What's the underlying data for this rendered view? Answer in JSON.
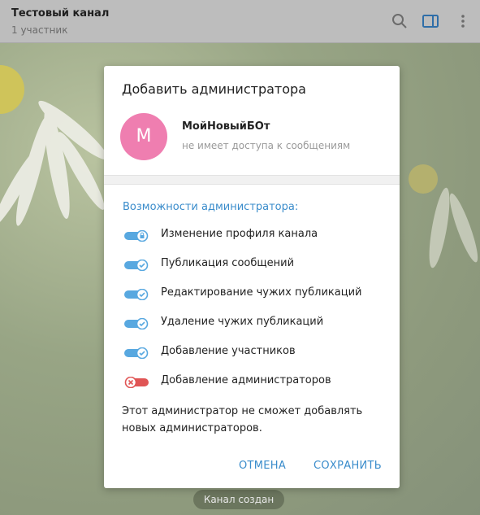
{
  "header": {
    "title": "Тестовый канал",
    "subtitle": "1 участник",
    "icons": [
      "search-icon",
      "sidebar-toggle-icon",
      "more-vertical-icon"
    ]
  },
  "background": {
    "pill_text": "Канал создан"
  },
  "dialog": {
    "title": "Добавить администратора",
    "avatar_letter": "М",
    "avatar_color": "#ef7eb0",
    "bot_name": "МойНовыйБОт",
    "bot_status": "не имеет доступа к сообщениям",
    "section_title": "Возможности администратора:",
    "permissions": [
      {
        "label": "Изменение профиля канала",
        "state": "locked-on"
      },
      {
        "label": "Публикация сообщений",
        "state": "on"
      },
      {
        "label": "Редактирование чужих публикаций",
        "state": "on"
      },
      {
        "label": "Удаление чужих публикаций",
        "state": "on"
      },
      {
        "label": "Добавление участников",
        "state": "on"
      },
      {
        "label": "Добавление администраторов",
        "state": "off"
      }
    ],
    "note_line1": "Этот администратор не сможет добавлять",
    "note_line2": "новых администраторов.",
    "cancel_label": "ОТМЕНА",
    "save_label": "СОХРАНИТЬ"
  },
  "colors": {
    "accent": "#3a8ccb",
    "toggle_on": "#58a8e0",
    "toggle_off": "#e05555",
    "header_bg": "#bdbdbd"
  }
}
